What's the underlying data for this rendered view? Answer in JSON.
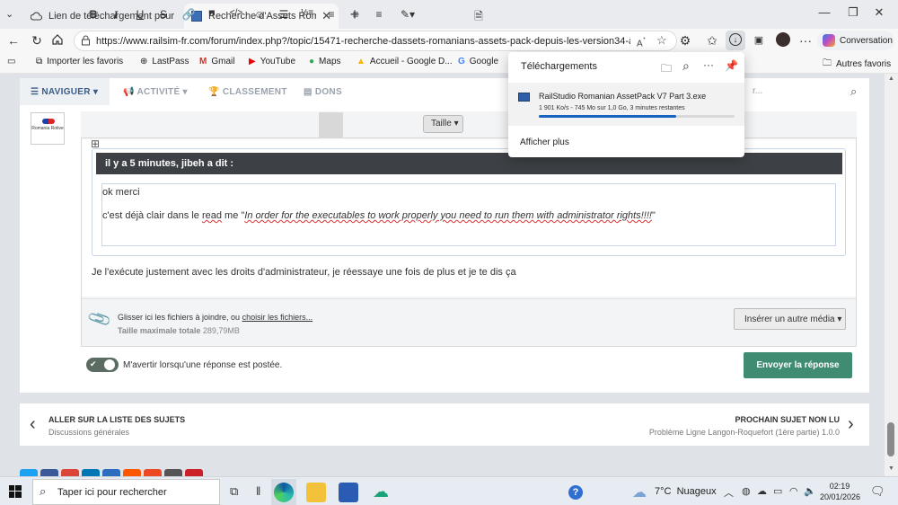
{
  "tabs": [
    {
      "label": "Lien de téléchargement pour RailS"
    },
    {
      "label": "Recherche d'Assets Romanians ass"
    }
  ],
  "address": {
    "url": "https://www.railsim-fr.com/forum/index.php?/topic/15471-recherche-dassets-romanians-assets-pack-depuis-les-version34-à-la-v...",
    "copilot": "Conversation"
  },
  "favorites": [
    "Importer les favoris",
    "LastPass",
    "Gmail",
    "YouTube",
    "Maps",
    "Accueil - Google D...",
    "Google"
  ],
  "favorites_other": "Autres favoris",
  "site_nav": [
    "NAVIGUER",
    "ACTIVITÉ",
    "CLASSEMENT",
    "DONS"
  ],
  "search_placeholder": "r...",
  "avatar_text": "Romania Rotive",
  "editor": {
    "size_label": "Taille"
  },
  "quote": {
    "header": "il y a 5 minutes, jibeh a dit :",
    "line1": "ok merci",
    "line2_prefix": "c'est déjà clair dans le ",
    "line2_readme": "read",
    "line2_mid": " me \"",
    "line2_italic": "In order for the executables to work properly you need to run them with administrator rights!!!!",
    "line2_end": "\""
  },
  "reply_text": "Je l'exécute justement avec les droits d'administrateur, je réessaye une fois de plus et je te dis ça",
  "attach": {
    "prefix": "Glisser ici les fichiers à joindre, ou ",
    "link": "choisir les fichiers...",
    "size_label": "Taille maximale totale",
    "size_value": "289,79MB",
    "insert_media": "Insérer un autre média ▾"
  },
  "notify_text": "M'avertir lorsqu'une réponse est postée.",
  "send_label": "Envoyer la réponse",
  "pager": {
    "back_label": "ALLER SUR LA LISTE DES SUJETS",
    "back_sub": "Discussions générales",
    "next_label": "PROCHAIN SUJET NON LU",
    "next_sub": "Problème Ligne Langon-Roquefort (1ère partie) 1.0.0"
  },
  "downloads": {
    "title": "Téléchargements",
    "file": "RailStudio Romanian AssetPack V7 Part 3.exe",
    "progress_text": "1 901 Ko/s - 745 Mo sur 1,0 Go, 3 minutes restantes",
    "progress": 0.7,
    "more": "Afficher plus"
  },
  "taskbar": {
    "search": "Taper ici pour rechercher",
    "temp": "7°C",
    "weather": "Nuageux",
    "time": "02:19",
    "date": "20/01/2026"
  },
  "colors": {
    "accent": "#3f8c72",
    "quote_header": "#3d4145",
    "progress": "#1565c0"
  }
}
